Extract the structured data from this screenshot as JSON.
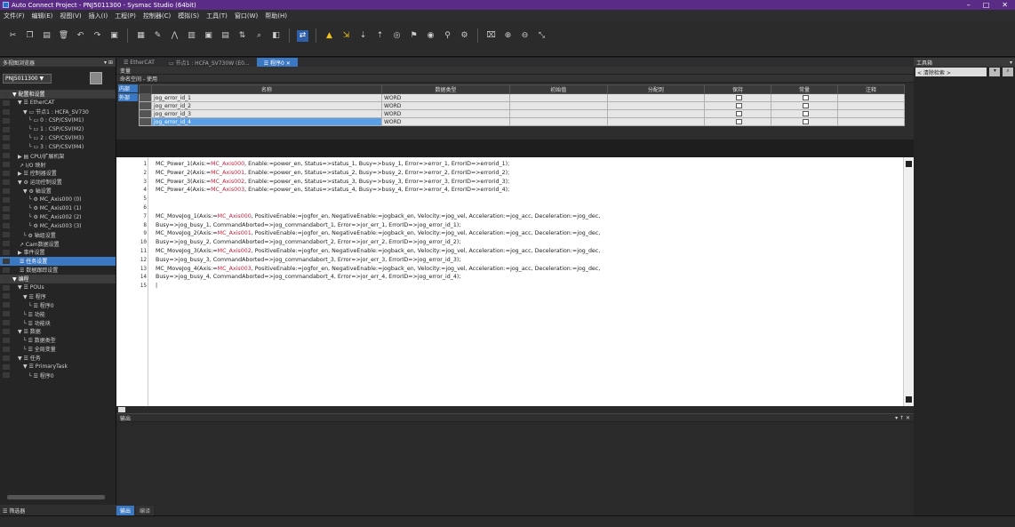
{
  "window": {
    "title": "Auto Connect Project - PNJ5011300 - Sysmac Studio (64bit)",
    "min": "–",
    "max": "□",
    "close": "✕"
  },
  "menu": [
    "文件(F)",
    "编辑(E)",
    "视图(V)",
    "插入(I)",
    "工程(P)",
    "控制器(C)",
    "模拟(S)",
    "工具(T)",
    "窗口(W)",
    "帮助(H)"
  ],
  "left": {
    "header": "多视图浏览器",
    "device": "PNJ5011300 ▼",
    "tree": [
      {
        "label": "▼ 配置和设置",
        "indent": 0,
        "head": true
      },
      {
        "label": "▼ ☰ EtherCAT",
        "indent": 6
      },
      {
        "label": "▼ ▭ 节点1 : HCFA_SV730",
        "indent": 12
      },
      {
        "label": "└ ▭ 0 : CSP/CSV(M1)",
        "indent": 18
      },
      {
        "label": "└ ▭ 1 : CSP/CSV(M2)",
        "indent": 18
      },
      {
        "label": "└ ▭ 2 : CSP/CSV(M3)",
        "indent": 18
      },
      {
        "label": "└ ▭ 3 : CSP/CSV(M4)",
        "indent": 18
      },
      {
        "label": "▶ ▤ CPU/扩展机架",
        "indent": 6
      },
      {
        "label": "↗ I/O 映射",
        "indent": 8
      },
      {
        "label": "▶ ☰ 控制器设置",
        "indent": 6
      },
      {
        "label": "▼ ⚙ 运动控制设置",
        "indent": 6
      },
      {
        "label": "▼ ⚙ 轴设置",
        "indent": 12
      },
      {
        "label": "└ ⚙ MC_Axis000 (0)",
        "indent": 18
      },
      {
        "label": "└ ⚙ MC_Axis001 (1)",
        "indent": 18
      },
      {
        "label": "└ ⚙ MC_Axis002 (2)",
        "indent": 18
      },
      {
        "label": "└ ⚙ MC_Axis003 (3)",
        "indent": 18
      },
      {
        "label": "└ ⚙ 轴组设置",
        "indent": 12
      },
      {
        "label": "↗ Cam数据设置",
        "indent": 8
      },
      {
        "label": "▶ 事件设置",
        "indent": 6
      },
      {
        "label": "☰ 任务设置",
        "indent": 8,
        "selected": true
      },
      {
        "label": "☰ 数据跟踪设置",
        "indent": 8
      },
      {
        "label": "▼ 编程",
        "indent": 0,
        "head": true
      },
      {
        "label": "▼ ☰ POUs",
        "indent": 6
      },
      {
        "label": "▼ ☰ 程序",
        "indent": 12
      },
      {
        "label": "└ ☰ 程序0",
        "indent": 18
      },
      {
        "label": "└ ☰ 功能",
        "indent": 12
      },
      {
        "label": "└ ☰ 功能块",
        "indent": 12
      },
      {
        "label": "▼ ☰ 数据",
        "indent": 6
      },
      {
        "label": "└ ☰ 数据类型",
        "indent": 12
      },
      {
        "label": "└ ☰ 全局变量",
        "indent": 12
      },
      {
        "label": "▼ ☰ 任务",
        "indent": 6
      },
      {
        "label": "▼ ☰ PrimaryTask",
        "indent": 12
      },
      {
        "label": "└ ☰ 程序0",
        "indent": 18
      }
    ],
    "footer": "☰ 筛选器"
  },
  "tabs": [
    {
      "label": "☰ EtherCAT",
      "active": false
    },
    {
      "label": "▭ 节点1 : HCFA_SV730W (E0...",
      "active": false
    },
    {
      "label": "☰ 程序0 ✕",
      "active": true
    }
  ],
  "var_section": {
    "header": "变量",
    "subheader": "命名空间 - 使用",
    "side_tabs": [
      "内部",
      "外部"
    ],
    "columns": [
      "名称",
      "数据类型",
      "初始值",
      "分配到",
      "保持",
      "常量",
      "注释"
    ],
    "rows": [
      {
        "name": "jog_error_id_1",
        "type": "WORD"
      },
      {
        "name": "jog_error_id_2",
        "type": "WORD"
      },
      {
        "name": "jog_error_id_3",
        "type": "WORD"
      },
      {
        "name": "jog_error_id_4",
        "type": "WORD",
        "selected": true
      }
    ]
  },
  "code": {
    "lines": [
      {
        "n": "1",
        "pre": "MC_Power_1(Axis:=",
        "axis": "MC_Axis000",
        "post": ", Enable:=power_en, Status=>status_1, Busy=>busy_1, Error=>error_1, ErrorID=>errorid_1);"
      },
      {
        "n": "2",
        "pre": "MC_Power_2(Axis:=",
        "axis": "MC_Axis001",
        "post": ", Enable:=power_en, Status=>status_2, Busy=>busy_2, Error=>error_2, ErrorID=>errorid_2);"
      },
      {
        "n": "3",
        "pre": "MC_Power_3(Axis:=",
        "axis": "MC_Axis002",
        "post": ", Enable:=power_en, Status=>status_3, Busy=>busy_3, Error=>error_3, ErrorID=>errorid_3);"
      },
      {
        "n": "4",
        "pre": "MC_Power_4(Axis:=",
        "axis": "MC_Axis003",
        "post": ", Enable:=power_en, Status=>status_4, Busy=>busy_4, Error=>error_4, ErrorID=>errorid_4);"
      },
      {
        "n": "5",
        "pre": "",
        "axis": "",
        "post": ""
      },
      {
        "n": "6",
        "pre": "",
        "axis": "",
        "post": ""
      },
      {
        "n": "7",
        "pre": "MC_MoveJog_1(Axis:=",
        "axis": "MC_Axis000",
        "post": ", PositiveEnable:=jogfor_en, NegativeEnable:=jogback_en, Velocity:=jog_vel, Acceleration:=jog_acc, Deceleration:=jog_dec,"
      },
      {
        "n": "8",
        "pre": "        Busy=>jog_busy_1, CommandAborted=>jog_commandabort_1, Error=>jor_err_1, ErrorID=>jog_error_id_1);",
        "axis": "",
        "post": ""
      },
      {
        "n": "9",
        "pre": "MC_MoveJog_2(Axis:=",
        "axis": "MC_Axis001",
        "post": ", PositiveEnable:=jogfor_en, NegativeEnable:=jogback_en, Velocity:=jog_vel, Acceleration:=jog_acc, Deceleration:=jog_dec,"
      },
      {
        "n": "10",
        "pre": "        Busy=>jog_busy_2, CommandAborted=>jog_commandabort_2, Error=>jor_err_2, ErrorID=>jog_error_id_2);",
        "axis": "",
        "post": ""
      },
      {
        "n": "11",
        "pre": "MC_MoveJog_3(Axis:=",
        "axis": "MC_Axis002",
        "post": ", PositiveEnable:=jogfor_en, NegativeEnable:=jogback_en, Velocity:=jog_vel, Acceleration:=jog_acc, Deceleration:=jog_dec,"
      },
      {
        "n": "12",
        "pre": "        Busy=>jog_busy_3, CommandAborted=>jog_commandabort_3, Error=>jor_err_3, ErrorID=>jog_error_id_3);",
        "axis": "",
        "post": ""
      },
      {
        "n": "13",
        "pre": "MC_MoveJog_4(Axis:=",
        "axis": "MC_Axis003",
        "post": ", PositiveEnable:=jogfor_en, NegativeEnable:=jogback_en, Velocity:=jog_vel, Acceleration:=jog_acc, Deceleration:=jog_dec,"
      },
      {
        "n": "14",
        "pre": "        Busy=>jog_busy_4, CommandAborted=>jog_commandabort_4, Error=>jor_err_4, ErrorID=>jog_error_id_4);",
        "axis": "",
        "post": ""
      },
      {
        "n": "15",
        "pre": "|",
        "axis": "",
        "post": ""
      }
    ]
  },
  "output": {
    "header": "输出",
    "tabs": [
      "输出",
      "编译"
    ],
    "controls": "▾ ↑ ✕"
  },
  "right": {
    "header": "工具箱",
    "search": "< 清除检索 >",
    "search_btn": "▾",
    "search_icon": "⌕"
  }
}
